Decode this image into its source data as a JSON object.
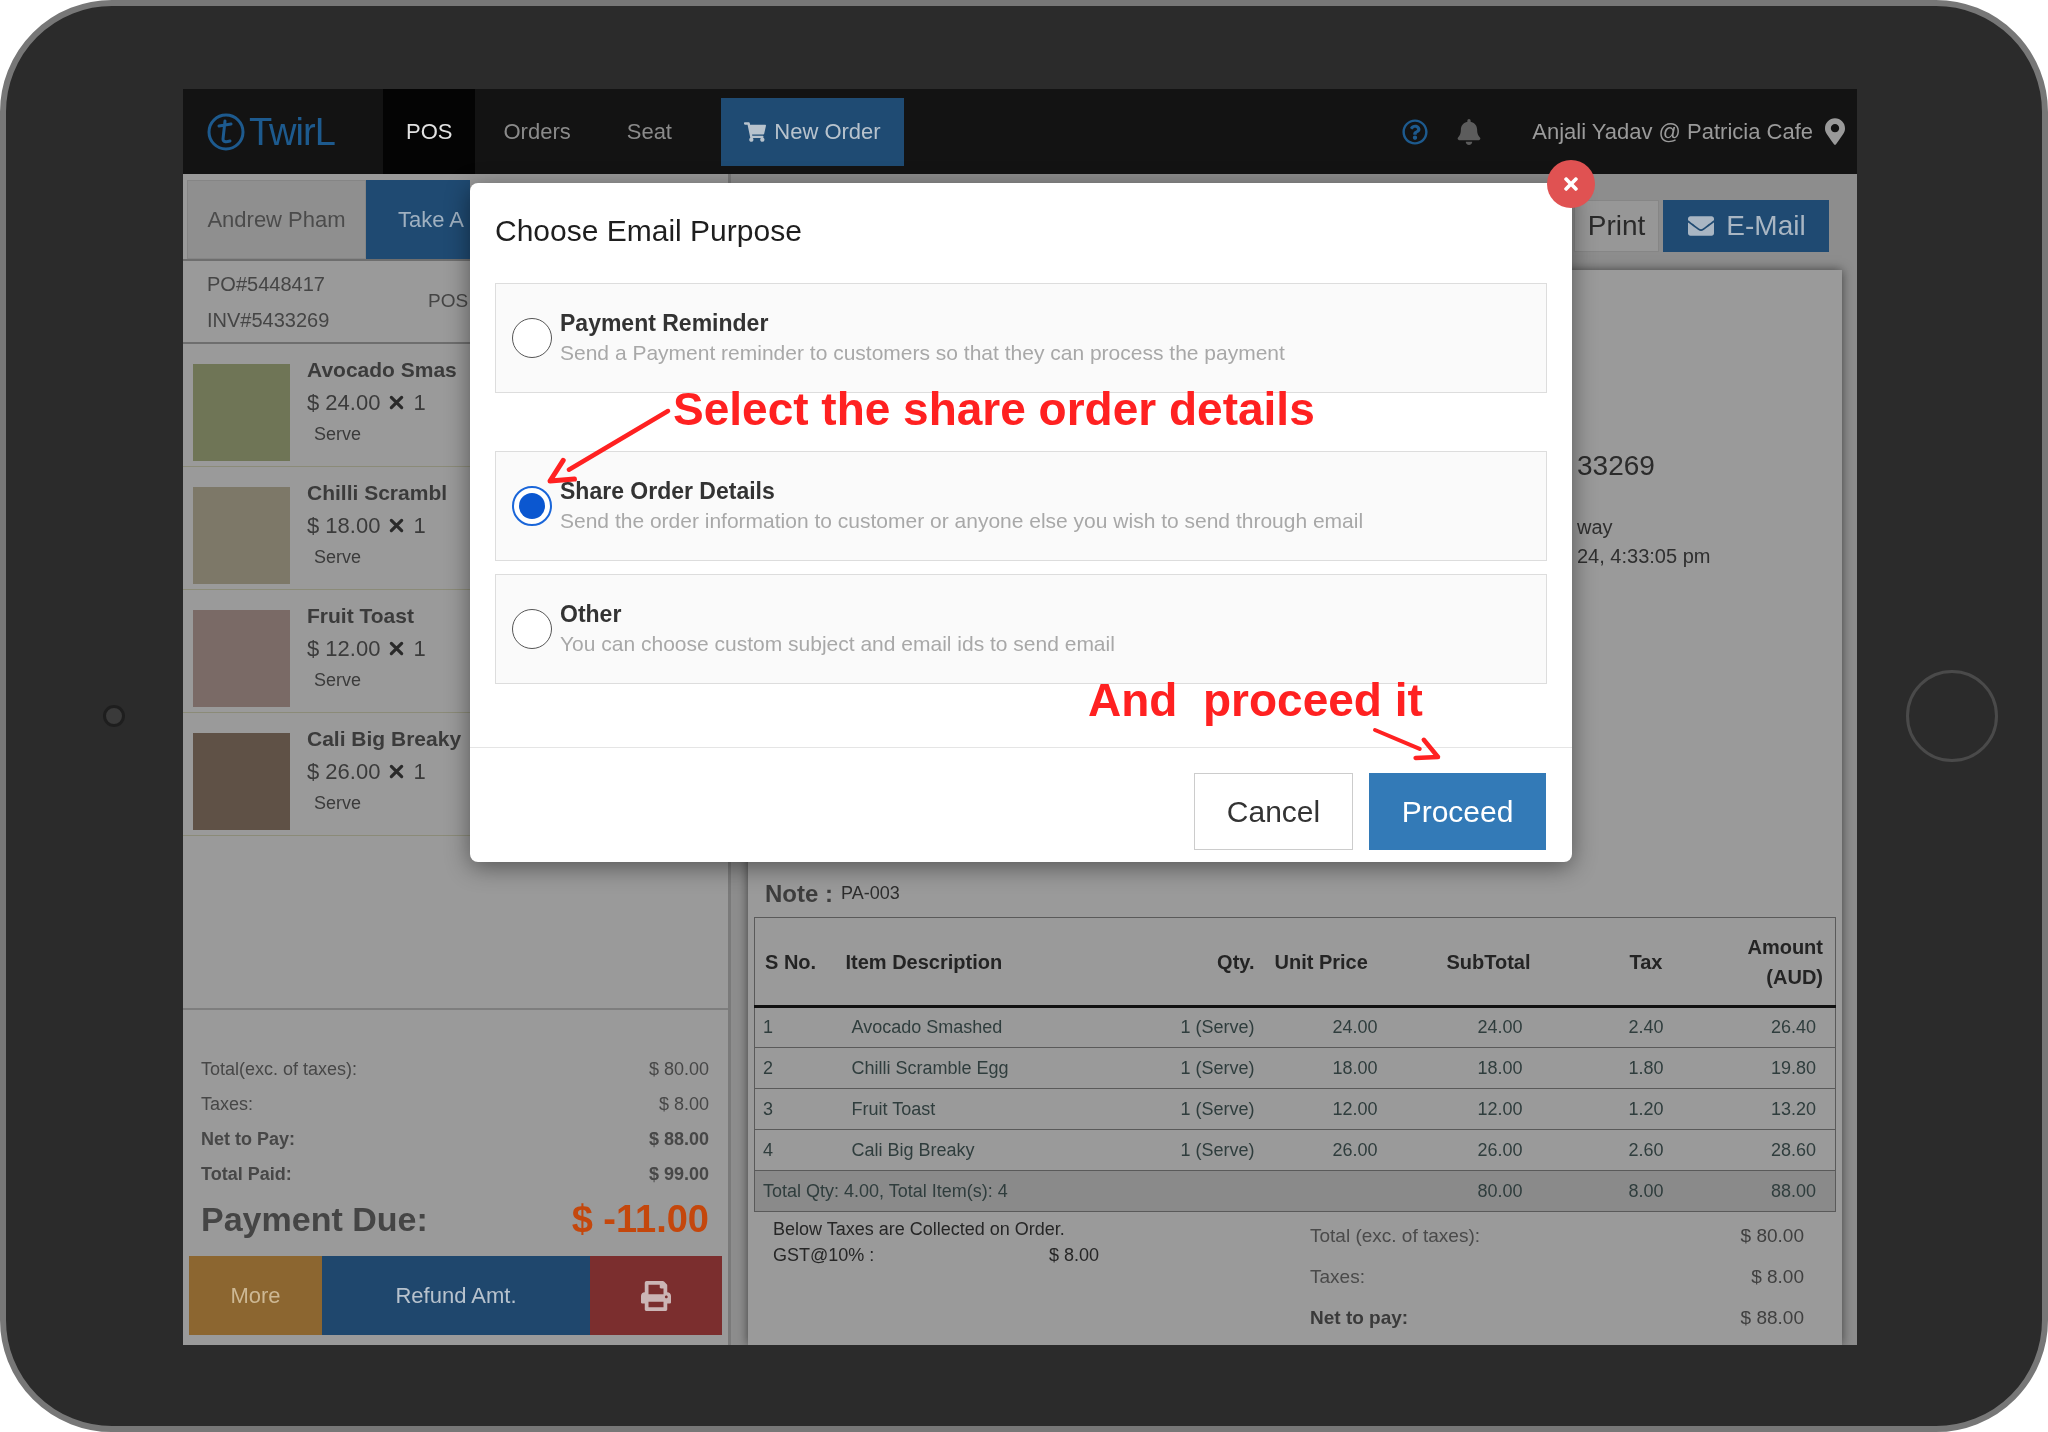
{
  "nav": {
    "logo": "TwirL",
    "tabs": [
      {
        "label": "POS",
        "selected": true
      },
      {
        "label": "Orders",
        "selected": false
      },
      {
        "label": "Seat",
        "selected": false
      }
    ],
    "new_order": "New Order",
    "user": "Anjali Yadav @ Patricia Cafe"
  },
  "order_panel": {
    "customer": "Andrew Pham",
    "order_type": "Take A",
    "po": "PO#5448417",
    "invoice": "INV#5433269",
    "source": "POS",
    "items": [
      {
        "name": "Avocado Smas",
        "price": "$ 24.00",
        "qty": "1",
        "unit": "Serve"
      },
      {
        "name": "Chilli Scrambl",
        "price": "$ 18.00",
        "qty": "1",
        "unit": "Serve"
      },
      {
        "name": "Fruit Toast",
        "price": "$ 12.00",
        "qty": "1",
        "unit": "Serve"
      },
      {
        "name": "Cali Big Breaky",
        "price": "$ 26.00",
        "qty": "1",
        "unit": "Serve"
      }
    ],
    "totals": [
      {
        "label": "Total(exc. of taxes):",
        "value": "$ 80.00",
        "kind": "plain"
      },
      {
        "label": "Taxes:",
        "value": "$ 8.00",
        "kind": "plain"
      },
      {
        "label": "Net to Pay:",
        "value": "$ 88.00",
        "kind": "strong"
      },
      {
        "label": "Total Paid:",
        "value": "$ 99.00",
        "kind": "strong"
      }
    ],
    "due": {
      "label": "Payment Due:",
      "value": "$ -11.00"
    },
    "buttons": [
      {
        "kind": "more",
        "label": "More"
      },
      {
        "kind": "refund",
        "label": "Refund Amt."
      },
      {
        "kind": "print"
      }
    ]
  },
  "receipt": {
    "actions": [
      {
        "kind": "print",
        "label": "Print"
      },
      {
        "kind": "email",
        "label": "E-Mail"
      }
    ],
    "invoice": "33269",
    "order_type": "way",
    "date": "24, 4:33:05 pm",
    "note_label": "Note :",
    "note": "PA-003",
    "table": {
      "columns": [
        "S No.",
        "Item Description",
        "Qty.",
        "Unit Price",
        "SubTotal",
        "Tax",
        "Amount (AUD)"
      ],
      "rows": [
        [
          "1",
          "Avocado Smashed",
          "1 (Serve)",
          "24.00",
          "24.00",
          "2.40",
          "26.40"
        ],
        [
          "2",
          "Chilli Scramble Egg",
          "1 (Serve)",
          "18.00",
          "18.00",
          "1.80",
          "19.80"
        ],
        [
          "3",
          "Fruit Toast",
          "1 (Serve)",
          "12.00",
          "12.00",
          "1.20",
          "13.20"
        ],
        [
          "4",
          "Cali Big Breaky",
          "1 (Serve)",
          "26.00",
          "26.00",
          "2.60",
          "28.60"
        ]
      ],
      "total_row": {
        "label": "Total Qty: 4.00, Total Item(s): 4",
        "values": [
          "80.00",
          "8.00",
          "88.00"
        ]
      }
    },
    "tax_note": "Below Taxes are Collected on Order.",
    "tax_lines": [
      {
        "label": "GST@10% :",
        "value": "$ 8.00"
      }
    ],
    "summary": [
      {
        "label": "Total (exc. of taxes):",
        "value": "$ 80.00",
        "kind": "plain"
      },
      {
        "label": "Taxes:",
        "value": "$ 8.00",
        "kind": "plain"
      },
      {
        "label": "Net to pay:",
        "value": "$ 88.00",
        "kind": "strong"
      }
    ]
  },
  "modal": {
    "title": "Choose Email Purpose",
    "options": [
      {
        "title": "Payment Reminder",
        "description": "Send a Payment reminder to customers so that they can process the payment",
        "selected": false
      },
      {
        "title": "Share Order Details",
        "description": "Send the order information to customer or anyone else you wish to send through email",
        "selected": true
      },
      {
        "title": "Other",
        "description": "You can choose custom subject and email ids to send email",
        "selected": false
      }
    ],
    "buttons": [
      {
        "kind": "secondary",
        "label": "Cancel"
      },
      {
        "kind": "primary",
        "label": "Proceed"
      }
    ]
  },
  "annotations": [
    {
      "text": "Select the share order details"
    },
    {
      "text": "And  proceed it"
    }
  ]
}
